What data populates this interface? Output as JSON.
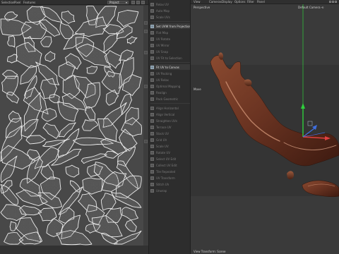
{
  "uv_editor": {
    "menu": [
      "Selection",
      "Pixel",
      "Features"
    ],
    "layer_dropdown": "Project",
    "colors": {
      "background": "#484848",
      "island_fill": "#5a5a5a",
      "island_stroke": "#e8e8e8"
    }
  },
  "command_list": {
    "items": [
      {
        "label": "Relax UV",
        "state": "dim"
      },
      {
        "label": "Auto Map",
        "state": "dim"
      },
      {
        "label": "Scale UVs",
        "state": "dim"
      },
      {
        "label": "Set UVW from Projection",
        "state": "active"
      },
      {
        "label": "Flat Map",
        "state": "dim"
      },
      {
        "label": "UV Rotate",
        "state": "dim"
      },
      {
        "label": "UV Mirror",
        "state": "dim"
      },
      {
        "label": "UV Snap",
        "state": "dim"
      },
      {
        "label": "UV Fit to Selection",
        "state": "dim"
      },
      {
        "label": "Fit UV to Canvas",
        "state": "active"
      },
      {
        "label": "UV Packing",
        "state": "dim"
      },
      {
        "label": "UV Relax",
        "state": "dim"
      },
      {
        "label": "Optimal Mapping",
        "state": "dim"
      },
      {
        "label": "Realign",
        "state": "dim"
      },
      {
        "label": "Pack Geometric",
        "state": "dim"
      },
      {
        "label": "Align Horizontal",
        "state": "dim"
      },
      {
        "label": "Align Vertical",
        "state": "dim"
      },
      {
        "label": "Straighten UVs",
        "state": "dim"
      },
      {
        "label": "Terrace UV",
        "state": "dim"
      },
      {
        "label": "Stack UV",
        "state": "dim"
      },
      {
        "label": "Grid UV",
        "state": "dim"
      },
      {
        "label": "Scale UV",
        "state": "dim"
      },
      {
        "label": "Rotate UV",
        "state": "dim"
      },
      {
        "label": "Select UV Edit",
        "state": "dim"
      },
      {
        "label": "Collect UV Edit",
        "state": "dim"
      },
      {
        "label": "Tile Repeated",
        "state": "dim"
      },
      {
        "label": "UV Transform",
        "state": "dim"
      },
      {
        "label": "Stitch UV",
        "state": "dim"
      },
      {
        "label": "Unwrap",
        "state": "dim"
      }
    ]
  },
  "viewport": {
    "menu": [
      "View",
      "Cameras",
      "Display",
      "Options",
      "Filter",
      "Panel"
    ],
    "projection_label": "Perspective",
    "camera_label": "Default Camera",
    "axis_hint": "Move",
    "status": "View Transform: Scene",
    "colors": {
      "background": "#3c3c3c",
      "floor": "#343434",
      "chocolate": "#6b3422",
      "highlight": "#c98d70",
      "axis_y": "#2fcf3c",
      "axis_x": "#e04040",
      "axis_z": "#3f6fe0"
    }
  }
}
